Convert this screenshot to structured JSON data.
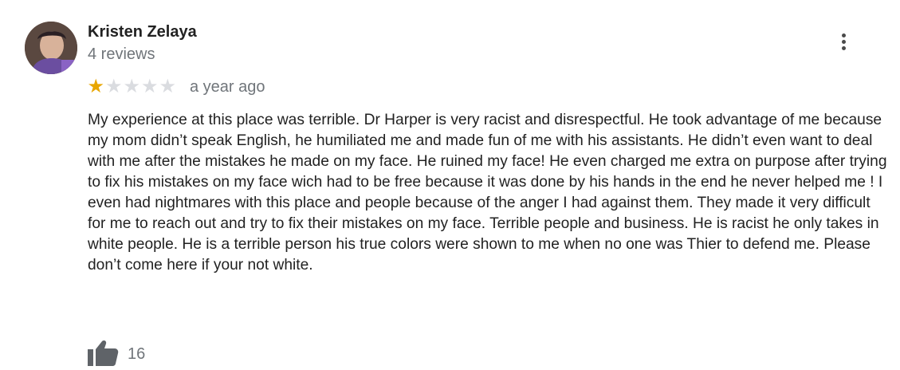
{
  "review": {
    "author_name": "Kristen Zelaya",
    "review_count": "4 reviews",
    "rating": 1,
    "rating_max": 5,
    "time_ago": "a year ago",
    "text": "My experience at this place was terrible. Dr Harper is very racist and disrespectful. He took advantage of me because my mom didn’t speak English, he humiliated me and made fun of me with his assistants. He didn’t even want to deal with me after the mistakes he made on my face. He ruined my face! He even charged me extra on purpose after trying to fix his mistakes on my face wich had to be free because it was done by his hands in the end he never helped me ! I even had nightmares with this place and people because of the anger I had against them. They made it very difficult for me to reach out and try to fix their mistakes on my face. Terrible people and business. He is racist he only takes in white people. He is a terrible person his true colors were shown to me when no one was Thier to defend me. Please don’t come here if your not white.",
    "like_count": "16"
  },
  "icons": {
    "avatar": "user-avatar-photo",
    "more": "more-vert-icon",
    "star_filled": "star-filled-icon",
    "star_empty": "star-empty-icon",
    "like": "thumbs-up-icon"
  },
  "colors": {
    "star_filled": "#e8a600",
    "star_empty": "#dadce0",
    "secondary_text": "#70757a",
    "primary_text": "#222222"
  }
}
